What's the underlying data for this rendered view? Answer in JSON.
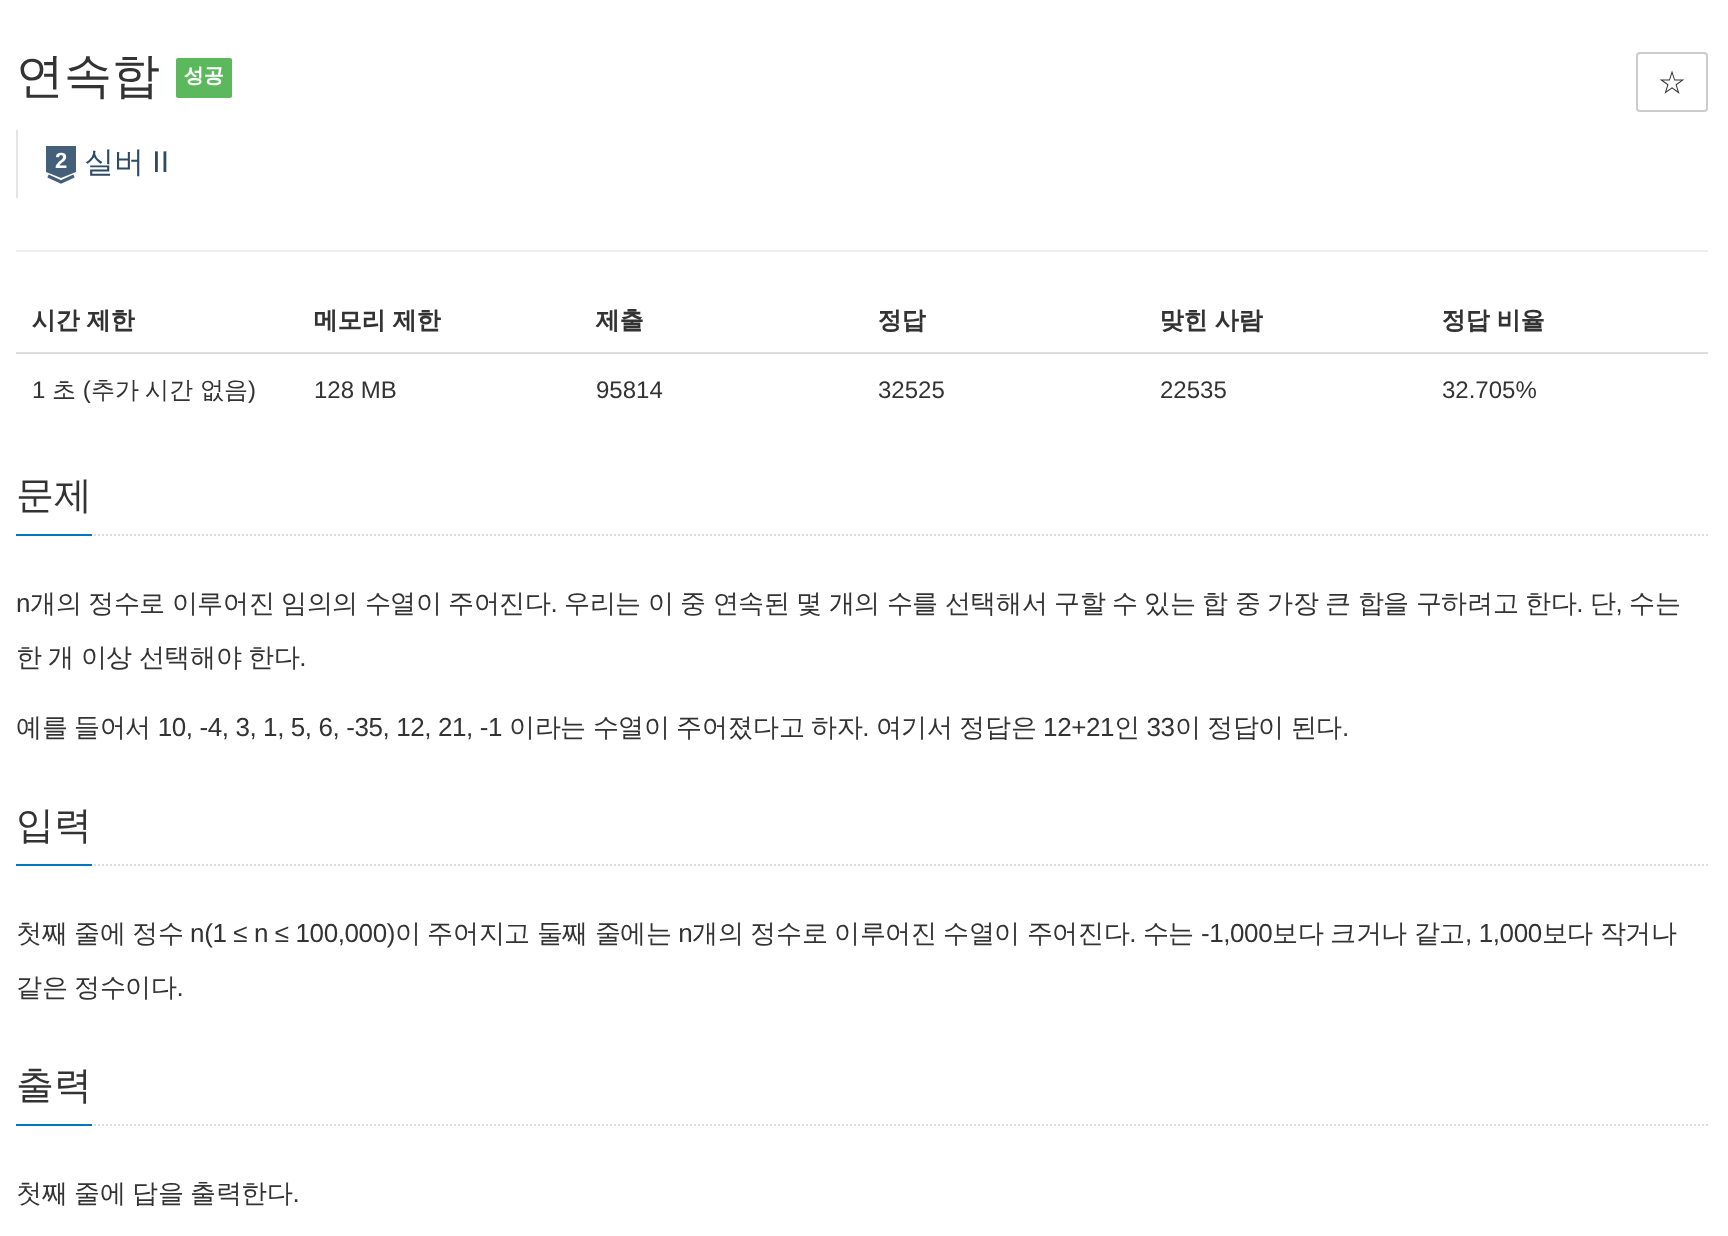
{
  "problem": {
    "title": "연속합",
    "result_badge": "성공",
    "star_button": "☆"
  },
  "tier": {
    "badge_number": "2",
    "label": "실버 II"
  },
  "info_table": {
    "columns": [
      "시간 제한",
      "메모리 제한",
      "제출",
      "정답",
      "맞힌 사람",
      "정답 비율"
    ],
    "rows": [
      [
        "1 초 (추가 시간 없음)",
        "128 MB",
        "95814",
        "32525",
        "22535",
        "32.705%"
      ]
    ]
  },
  "sections": [
    {
      "heading": "문제",
      "paragraphs": [
        "n개의 정수로 이루어진 임의의 수열이 주어진다. 우리는 이 중 연속된 몇 개의 수를 선택해서 구할 수 있는 합 중 가장 큰 합을 구하려고 한다. 단, 수는 한 개 이상 선택해야 한다.",
        "예를 들어서 10, -4, 3, 1, 5, 6, -35, 12, 21, -1 이라는 수열이 주어졌다고 하자. 여기서 정답은 12+21인 33이 정답이 된다."
      ]
    },
    {
      "heading": "입력",
      "paragraphs": [
        "첫째 줄에 정수 n(1 ≤ n ≤ 100,000)이 주어지고 둘째 줄에는 n개의 정수로 이루어진 수열이 주어진다. 수는 -1,000보다 크거나 같고, 1,000보다 작거나 같은 정수이다."
      ]
    },
    {
      "heading": "출력",
      "paragraphs": [
        "첫째 줄에 답을 출력한다."
      ]
    }
  ]
}
